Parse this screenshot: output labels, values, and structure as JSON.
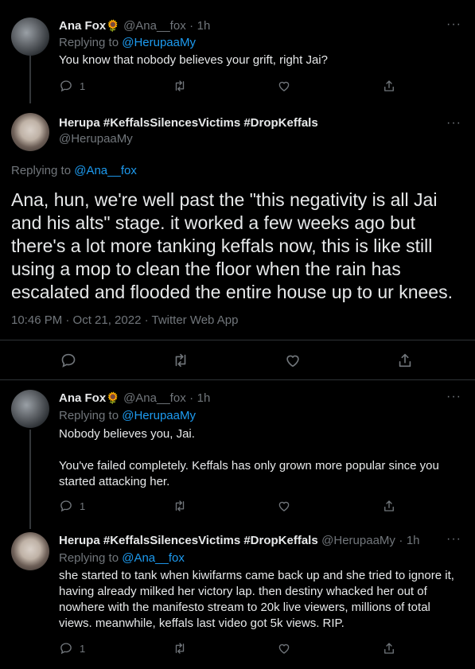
{
  "tweets": [
    {
      "name": "Ana Fox",
      "emoji": "🌻",
      "handle": "@Ana__fox",
      "time": "1h",
      "replying_label": "Replying to ",
      "replying_handle": "@HerupaaMy",
      "text": "You know that nobody believes your grift, right Jai?",
      "reply_count": "1"
    },
    {
      "name": "Ana Fox",
      "emoji": "🌻",
      "handle": "@Ana__fox",
      "time": "1h",
      "replying_label": "Replying to ",
      "replying_handle": "@HerupaaMy",
      "text": "Nobody believes you, Jai.\n\nYou've failed completely. Keffals has only grown more popular since you started attacking her.",
      "reply_count": "1"
    },
    {
      "name": "Herupa #KeffalsSilencesVictims #DropKeffals",
      "handle": "@HerupaaMy",
      "time": "1h",
      "replying_label": "Replying to ",
      "replying_handle": "@Ana__fox",
      "text": "she started to tank when kiwifarms came back up and she tried to ignore it, having already milked her victory lap. then destiny whacked her out of nowhere with the manifesto stream to 20k live viewers, millions of total views. meanwhile, keffals last video got 5k views. RIP.",
      "reply_count": "1"
    }
  ],
  "main_tweet": {
    "name": "Herupa #KeffalsSilencesVictims #DropKeffals",
    "handle": "@HerupaaMy",
    "replying_label": "Replying to ",
    "replying_handle": "@Ana__fox",
    "text": "Ana, hun, we're well past the \"this negativity is all Jai and his alts\" stage. it worked a few weeks ago but there's a lot more tanking keffals now, this is like still using a mop to clean the floor when the rain has escalated and flooded the entire house up to ur knees.",
    "timestamp": "10:46 PM · Oct 21, 2022 · Twitter Web App"
  },
  "separator_dot": "·",
  "more_glyph": "···",
  "icons": [
    "reply-icon",
    "retweet-icon",
    "like-icon",
    "share-icon",
    "more-icon"
  ],
  "colors": {
    "background": "#000000",
    "text": "#e7e9ea",
    "muted": "#71767b",
    "link": "#1d9bf0",
    "divider": "#2f3336"
  }
}
